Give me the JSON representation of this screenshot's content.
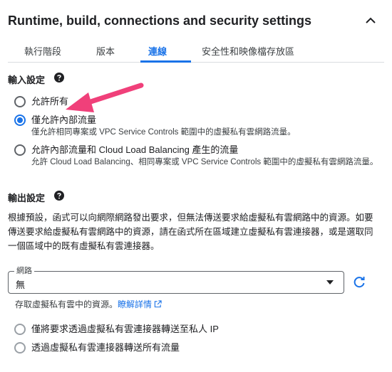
{
  "header": {
    "title": "Runtime, build, connections and security settings"
  },
  "tabs": [
    {
      "label": "執行階段",
      "active": false
    },
    {
      "label": "版本",
      "active": false
    },
    {
      "label": "連線",
      "active": true
    },
    {
      "label": "安全性和映像檔存放區",
      "active": false
    }
  ],
  "ingress": {
    "label": "輸入設定",
    "options": [
      {
        "label": "允許所有",
        "checked": false,
        "description": ""
      },
      {
        "label": "僅允許內部流量",
        "checked": true,
        "description": "僅允許相同專案或 VPC Service Controls 範圍中的虛擬私有雲網路流量。"
      },
      {
        "label": "允許內部流量和 Cloud Load Balancing 產生的流量",
        "checked": false,
        "description": "允許 Cloud Load Balancing、相同專案或 VPC Service Controls 範圍中的虛擬私有雲網路流量。"
      }
    ]
  },
  "egress": {
    "label": "輸出設定",
    "description": "根據預設，函式可以向網際網路發出要求，但無法傳送要求給虛擬私有雲網路中的資源。如要傳送要求給虛擬私有雲網路中的資源，請在函式所在區域建立虛擬私有雲連接器，或是選取同一個區域中的既有虛擬私有雲連接器。",
    "network": {
      "label": "網路",
      "value": "無"
    },
    "helper": {
      "text": "存取虛擬私有雲中的資源。",
      "link": "瞭解詳情"
    },
    "routing": [
      {
        "label": "僅將要求透過虛擬私有雲連接器轉送至私人 IP",
        "checked": false
      },
      {
        "label": "透過虛擬私有雲連接器轉送所有流量",
        "checked": false
      }
    ]
  },
  "colors": {
    "accent": "#1a73e8",
    "annotation_arrow": "#f0407a"
  }
}
